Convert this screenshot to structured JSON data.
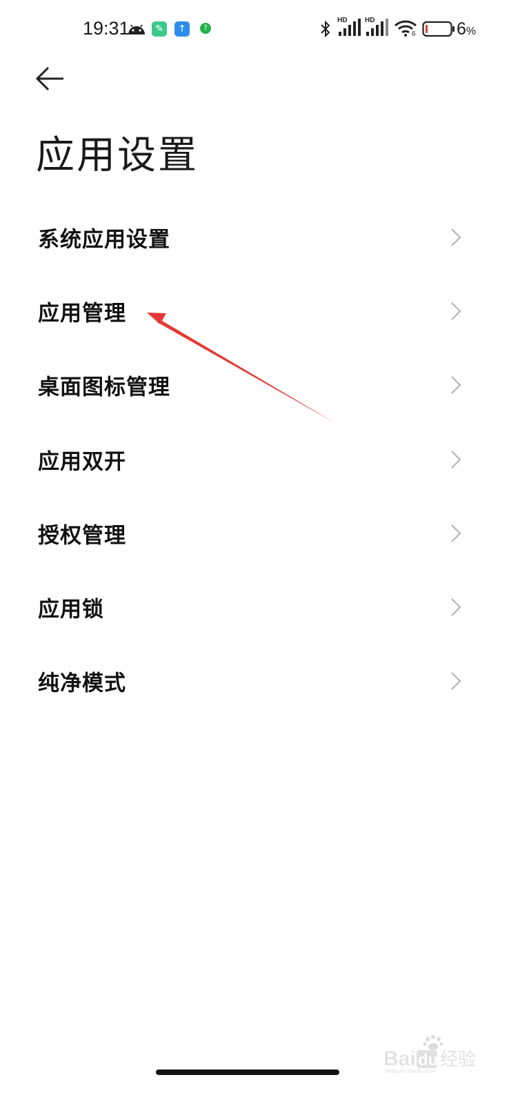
{
  "status_bar": {
    "time": "19:31",
    "network_label_1": "HD",
    "network_label_2": "HD",
    "wifi_label": "6",
    "battery_percent": "6",
    "battery_unit": "%",
    "icons": [
      "android-icon",
      "tool-app-icon",
      "upload-app-icon",
      "help-app-icon",
      "bluetooth-icon",
      "signal-icon",
      "signal-icon",
      "wifi-icon",
      "battery-icon"
    ],
    "battery_level": 0.06,
    "battery_color": "#e53935"
  },
  "header": {
    "title": "应用设置"
  },
  "menu": {
    "items": [
      {
        "label": "系统应用设置"
      },
      {
        "label": "应用管理"
      },
      {
        "label": "桌面图标管理"
      },
      {
        "label": "应用双开"
      },
      {
        "label": "授权管理"
      },
      {
        "label": "应用锁"
      },
      {
        "label": "纯净模式"
      }
    ]
  },
  "annotation": {
    "color": "#e53935"
  },
  "watermark": {
    "text": "Baidu经验",
    "subtext": "jingyan.baidu.com"
  }
}
